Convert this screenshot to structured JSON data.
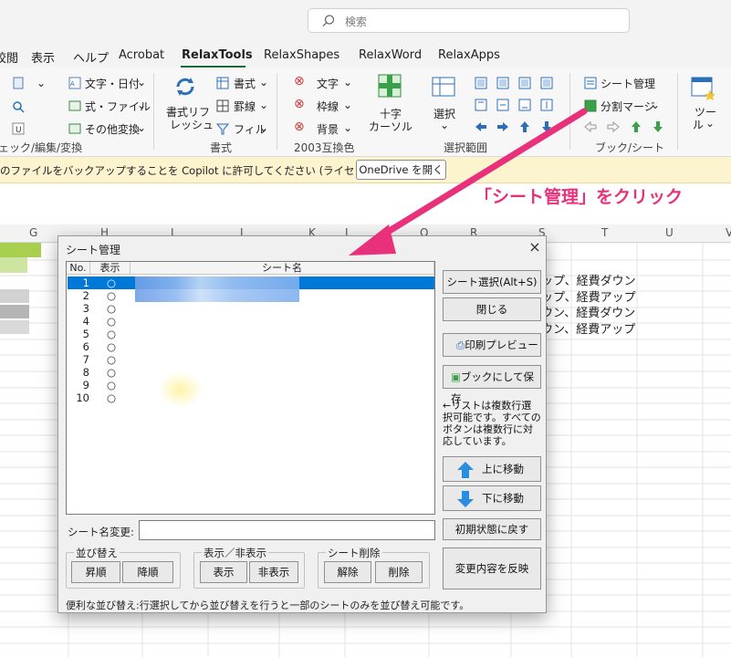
{
  "search": {
    "placeholder": "検索"
  },
  "ribbon_tabs": [
    "校閲",
    "表示",
    "ヘルプ",
    "Acrobat",
    "RelaxTools",
    "RelaxShapes",
    "RelaxWord",
    "RelaxApps"
  ],
  "ribbon": {
    "buttons": {
      "text_date": "文字・日付",
      "formula_file": "式・ファイル",
      "other_convert": "その他変換",
      "format_refresh_1": "書式リフ",
      "format_refresh_2": "レッシュ",
      "format_menu": "書式",
      "border_menu": "罫線",
      "filter_menu": "フィル",
      "char_2003": "文字",
      "border_2003": "枠線",
      "bg_2003": "背景",
      "cross_cursor_1": "十字",
      "cross_cursor_2": "カーソル",
      "select": "選択",
      "sheet_manage": "シート管理",
      "split_merge": "分割マージ",
      "tools": "ツー",
      "tools_2": "ル"
    },
    "groups": {
      "check": "ェック/編集/変換",
      "format": "書式",
      "compat2003": "2003互換色",
      "range": "選択範囲",
      "book_sheet": "ブック/シート"
    }
  },
  "infobar": {
    "text": "のファイルをバックアップすることを Copilot に許可してください (ライセンスが必要です)。",
    "button": "OneDrive を開く"
  },
  "sheet": {
    "columns": [
      "G",
      "H",
      "I",
      "J",
      "K",
      "L",
      "Q",
      "R",
      "S",
      "T",
      "U",
      "V"
    ],
    "cells": [
      "ップ、経費ダウン",
      "ップ、経費アップ",
      "ウン、経費ダウン",
      "ウン、経費アップ"
    ]
  },
  "annotation": "「シート管理」をクリック",
  "dialog": {
    "title": "シート管理",
    "close": "×",
    "list_headers": {
      "no": "No.",
      "show": "表示",
      "name": "シート名"
    },
    "rows": [
      {
        "no": "1",
        "show": "○"
      },
      {
        "no": "2",
        "show": "○"
      },
      {
        "no": "3",
        "show": "○"
      },
      {
        "no": "4",
        "show": "○"
      },
      {
        "no": "5",
        "show": "○"
      },
      {
        "no": "6",
        "show": "○"
      },
      {
        "no": "7",
        "show": "○"
      },
      {
        "no": "8",
        "show": "○"
      },
      {
        "no": "9",
        "show": "○"
      },
      {
        "no": "10",
        "show": "○"
      }
    ],
    "buttons": {
      "select_sheet": "シート選択(Alt+S)",
      "close": "閉じる",
      "print_preview": "印刷プレビュー",
      "save_as_book": "ブックにして保存",
      "move_up": "上に移動",
      "move_down": "下に移動",
      "reset": "初期状態に戻す",
      "apply": "変更内容を反映",
      "asc": "昇順",
      "desc": "降順",
      "show": "表示",
      "hide": "非表示",
      "unprotect": "解除",
      "delete": "削除"
    },
    "hint": "←リストは複数行選択可能です。すべてのボタンは複数行に対応しています。",
    "rename_label": "シート名変更:",
    "rename_value": "",
    "group_sort": "並び替え",
    "group_visibility": "表示／非表示",
    "group_delete": "シート削除",
    "footer": "便利な並び替え:行選択してから並び替えを行うと一部のシートのみを並び替え可能です。"
  },
  "colors": {
    "accent": "#1c6b35",
    "selection": "#0078d7",
    "annotation": "#e8317a"
  }
}
